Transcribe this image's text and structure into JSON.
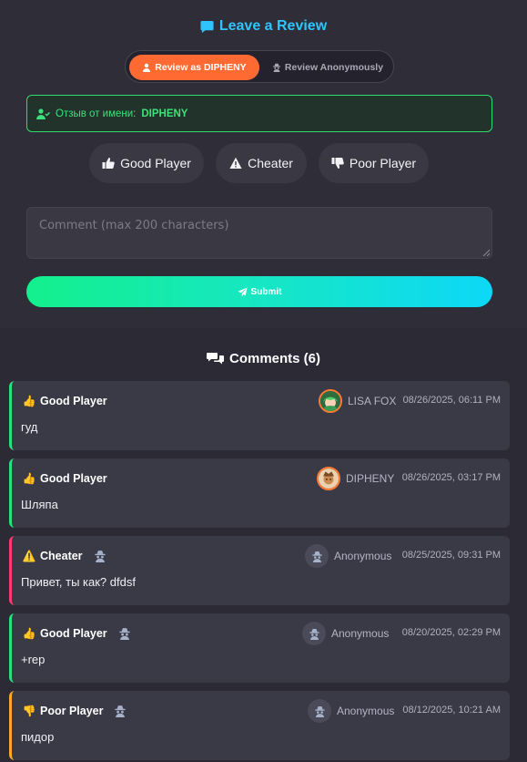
{
  "review_form": {
    "title": "Leave a Review",
    "title_color": "#2fc4ff",
    "mode_options": [
      "Review as DIPHENY",
      "Review Anonymously"
    ],
    "selected_mode": "Review as DIPHENY",
    "identity_label": "Отзыв от имени:",
    "identity_name": "DIPHENY",
    "rating_buttons": [
      {
        "label": "Good Player",
        "icon": "thumbs-up-icon"
      },
      {
        "label": "Cheater",
        "icon": "warning-icon"
      },
      {
        "label": "Poor Player",
        "icon": "thumbs-down-icon"
      }
    ],
    "comment_value": "",
    "comment_placeholder": "Comment (max 200 characters)",
    "submit_label": "Submit",
    "accent_color": "#ff6a33",
    "success_color": "#2edb6e"
  },
  "comments": {
    "title": "Comments (6)",
    "items": [
      {
        "rating": "Good Player",
        "emoji": "👍",
        "text": "гуд",
        "author": "LISA FOX",
        "anonymous": false,
        "date": "08/26/2025, 06:11 PM",
        "accent": "#25e27f"
      },
      {
        "rating": "Good Player",
        "emoji": "👍",
        "text": "Шляпа",
        "author": "DIPHENY",
        "anonymous": false,
        "date": "08/26/2025, 03:17 PM",
        "accent": "#25e27f"
      },
      {
        "rating": "Cheater",
        "emoji": "⚠️",
        "text": "Привет, ты как? dfdsf",
        "author": "Anonymous",
        "anonymous": true,
        "date": "08/25/2025, 09:31 PM",
        "accent": "#ff3b6d"
      },
      {
        "rating": "Good Player",
        "emoji": "👍",
        "text": "+rep",
        "author": "Anonymous",
        "anonymous": true,
        "date": "08/20/2025, 02:29 PM",
        "accent": "#25e27f"
      },
      {
        "rating": "Poor Player",
        "emoji": "👎",
        "text": "пидор",
        "author": "Anonymous",
        "anonymous": true,
        "date": "08/12/2025, 10:21 AM",
        "accent": "#ffa726"
      }
    ]
  }
}
